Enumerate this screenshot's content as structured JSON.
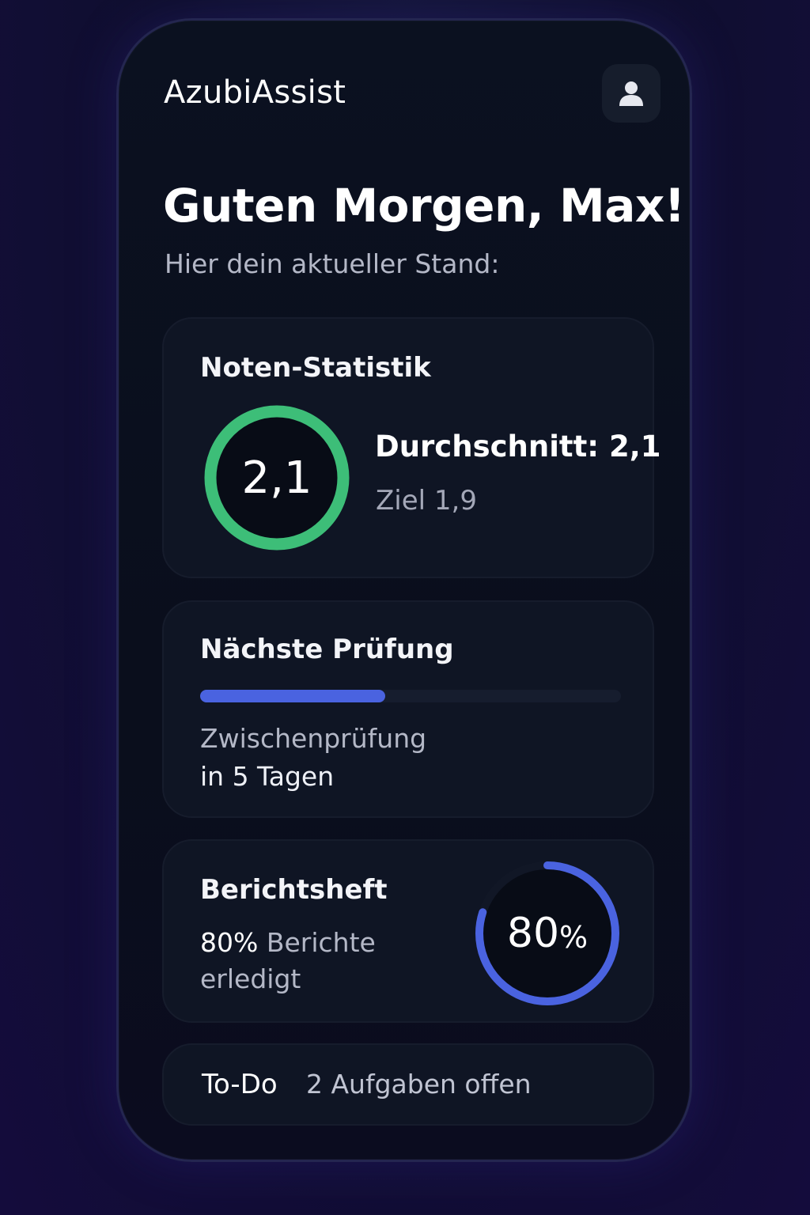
{
  "app": {
    "title": "AzubiAssist",
    "profile_icon": "user-icon"
  },
  "header": {
    "greeting": "Guten Morgen, Max!",
    "subtitle": "Hier dein aktueller Stand:"
  },
  "grades": {
    "title": "Noten-Statistik",
    "value": "2,1",
    "average_label": "Durchschnitt: 2,1",
    "goal_label": "Ziel 1,9",
    "ring_color": "#3dbe78"
  },
  "exam": {
    "title": "Nächste Prüfung",
    "progress": 0.44,
    "progress_color": "#4a63e0",
    "name": "Zwischenprüfung",
    "when": "in 5 Tagen"
  },
  "report": {
    "title": "Berichtsheft",
    "percent_text": "80%",
    "status_text": "Berichte erledigt",
    "ring_value": "80",
    "ring_unit": "%",
    "progress": 0.8,
    "ring_color": "#4a63e0"
  },
  "todo": {
    "label": "To-Do",
    "count_text": "2 Aufgaben offen"
  }
}
